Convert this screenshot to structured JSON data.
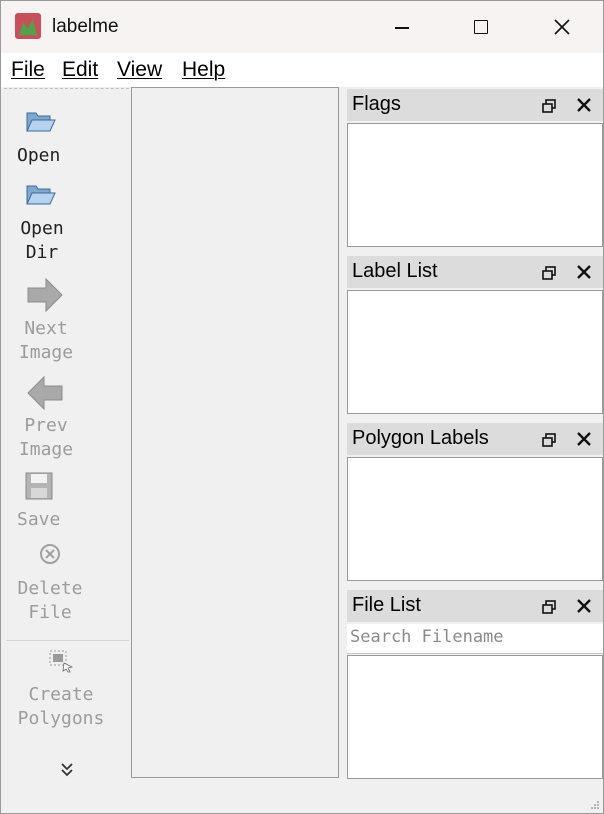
{
  "window": {
    "title": "labelme",
    "icon": "labelme-app-icon"
  },
  "window_controls": {
    "minimize": "minimize-icon",
    "maximize": "maximize-icon",
    "close": "close-icon"
  },
  "menubar": [
    "File",
    "Edit",
    "View",
    "Help"
  ],
  "toolbar": {
    "items": [
      {
        "label": "Open",
        "icon": "folder-open-icon",
        "enabled": true
      },
      {
        "label": "Open\nDir",
        "icon": "folder-open-icon",
        "enabled": true
      },
      {
        "label": "Next\nImage",
        "icon": "arrow-right-icon",
        "enabled": false
      },
      {
        "label": "Prev\nImage",
        "icon": "arrow-left-icon",
        "enabled": false
      },
      {
        "label": "Save",
        "icon": "floppy-disk-icon",
        "enabled": false
      },
      {
        "label": "Delete\nFile",
        "icon": "delete-icon",
        "enabled": false
      },
      {
        "label": "Create\nPolygons",
        "icon": "create-polygon-icon",
        "enabled": false
      }
    ],
    "overflow_icon": "chevron-double-down-icon"
  },
  "docks": [
    {
      "title": "Flags"
    },
    {
      "title": "Label List"
    },
    {
      "title": "Polygon Labels"
    },
    {
      "title": "File List",
      "search_placeholder": "Search Filename"
    }
  ]
}
